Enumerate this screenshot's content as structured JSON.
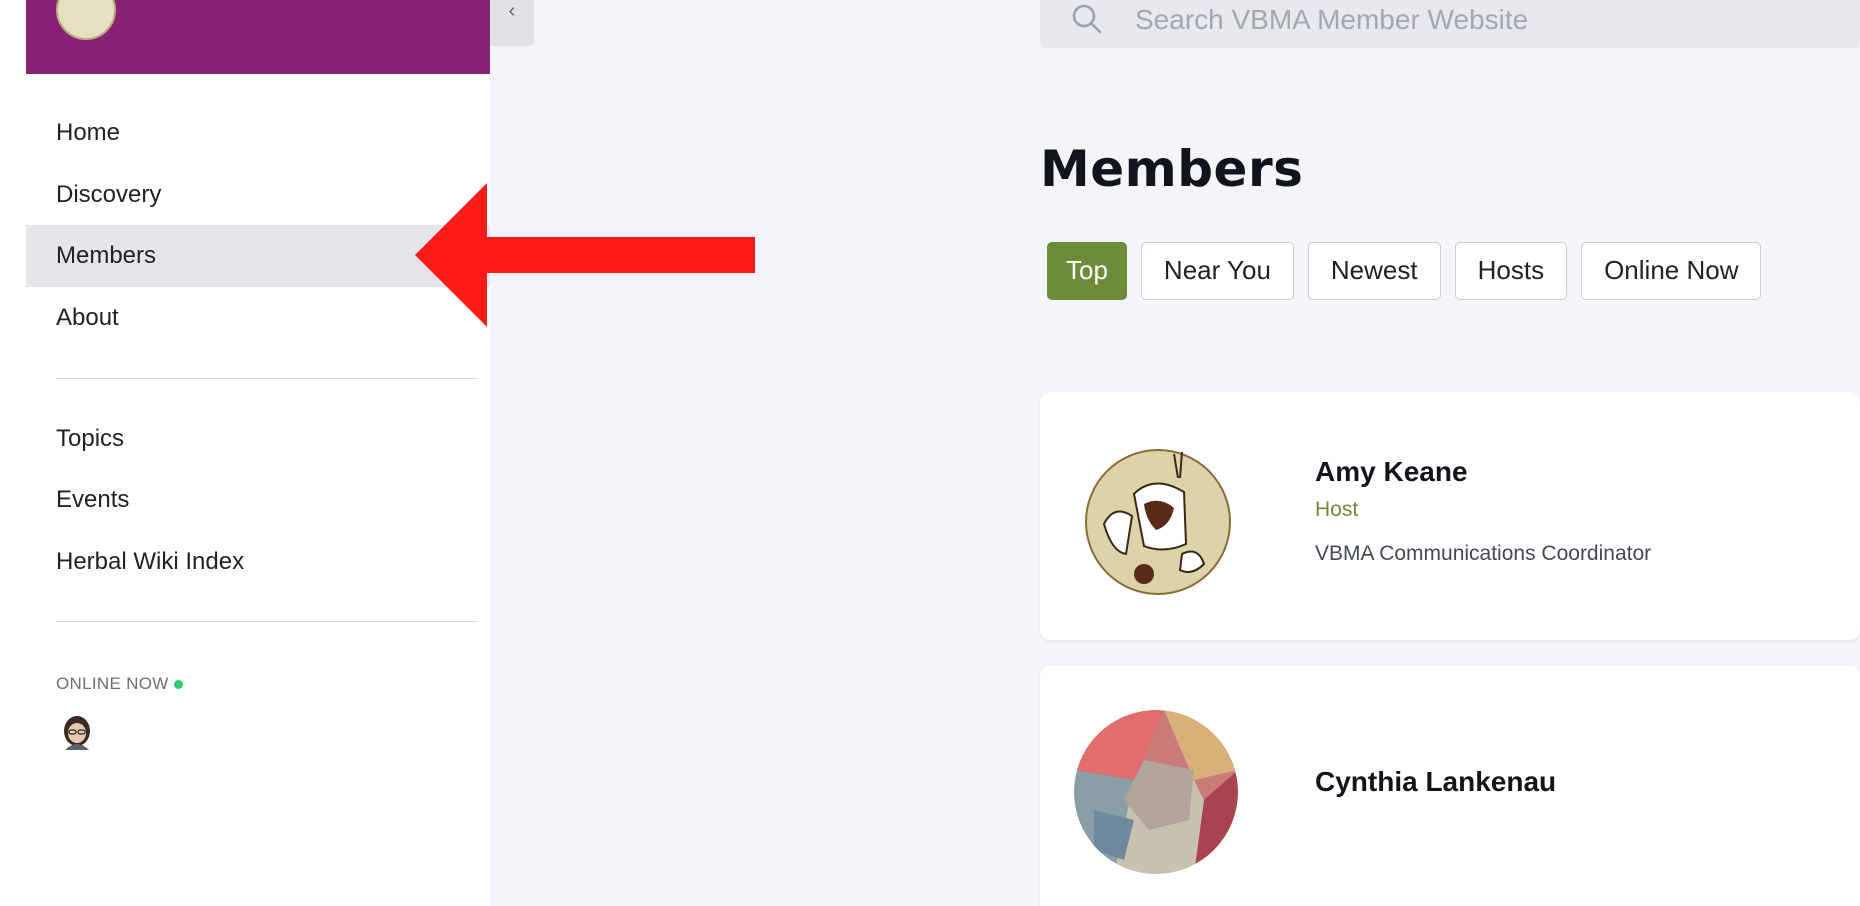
{
  "sidebar": {
    "nav_primary": [
      {
        "label": "Home"
      },
      {
        "label": "Discovery"
      },
      {
        "label": "Members",
        "active": true
      },
      {
        "label": "About"
      }
    ],
    "nav_secondary": [
      {
        "label": "Topics"
      },
      {
        "label": "Events"
      },
      {
        "label": "Herbal Wiki Index"
      }
    ],
    "online_now_label": "ONLINE NOW",
    "brand_color": "#862173"
  },
  "search": {
    "placeholder": "Search VBMA Member Website",
    "icon": "search-icon"
  },
  "page": {
    "title": "Members"
  },
  "filters": [
    {
      "label": "Top",
      "active": true
    },
    {
      "label": "Near You"
    },
    {
      "label": "Newest"
    },
    {
      "label": "Hosts"
    },
    {
      "label": "Online Now"
    }
  ],
  "members": [
    {
      "name": "Amy Keane",
      "role": "Host",
      "title": "VBMA Communications Coordinator"
    },
    {
      "name": "Cynthia Lankenau"
    }
  ],
  "colors": {
    "accent_green": "#6c8c3a",
    "annotation_red": "#ff1a1a",
    "online_green": "#2ecc71"
  }
}
